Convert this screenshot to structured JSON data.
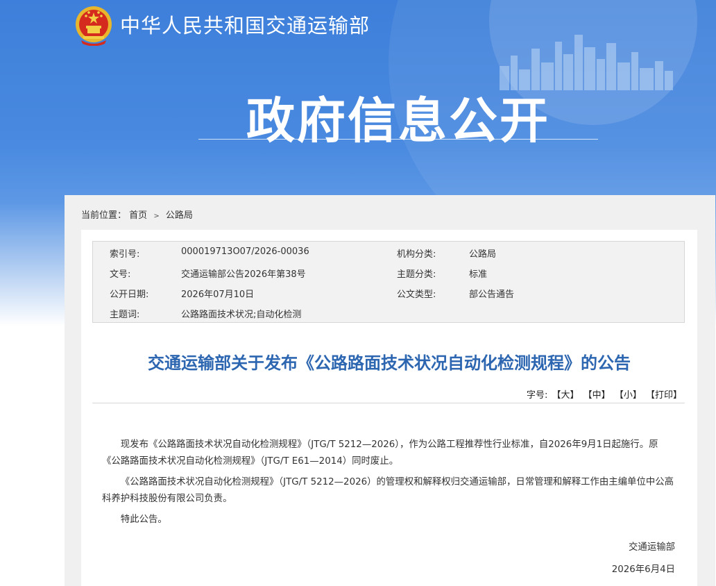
{
  "header": {
    "site_name": "中华人民共和国交通运输部",
    "banner_title": "政府信息公开",
    "emblem_icon": "national-emblem-icon"
  },
  "breadcrumb": {
    "label": "当前位置：",
    "items": [
      "首页",
      "公路局"
    ],
    "separator": ">"
  },
  "meta": {
    "index_label": "索引号:",
    "index_value": "000019713O07/2026-00036",
    "org_label": "机构分类:",
    "org_value": "公路局",
    "docno_label": "文号:",
    "docno_value": "交通运输部公告2026年第38号",
    "theme_label": "主题分类:",
    "theme_value": "标准",
    "date_label": "公开日期:",
    "date_value": "2026年07月10日",
    "type_label": "公文类型:",
    "type_value": "部公告通告",
    "keywords_label": "主题词:",
    "keywords_value": "公路路面技术状况;自动化检测"
  },
  "article": {
    "title": "交通运输部关于发布《公路路面技术状况自动化检测规程》的公告",
    "fontsize_label": "字号:",
    "fontsize_large": "【大】",
    "fontsize_medium": "【中】",
    "fontsize_small": "【小】",
    "print_label": "【打印】",
    "paragraphs": [
      "现发布《公路路面技术状况自动化检测规程》（JTG/T 5212—2026），作为公路工程推荐性行业标准，自2026年9月1日起施行。原《公路路面技术状况自动化检测规程》（JTG/T E61—2014）同时废止。",
      "《公路路面技术状况自动化检测规程》（JTG/T 5212—2026）的管理权和解释权归交通运输部，日常管理和解释工作由主编单位中公高科养护科技股份有限公司负责。",
      "特此公告。"
    ],
    "signature": "交通运输部",
    "sign_date": "2026年6月4日"
  },
  "colors": {
    "banner_blue": "#3d7fda",
    "title_blue": "#2d66b0"
  }
}
